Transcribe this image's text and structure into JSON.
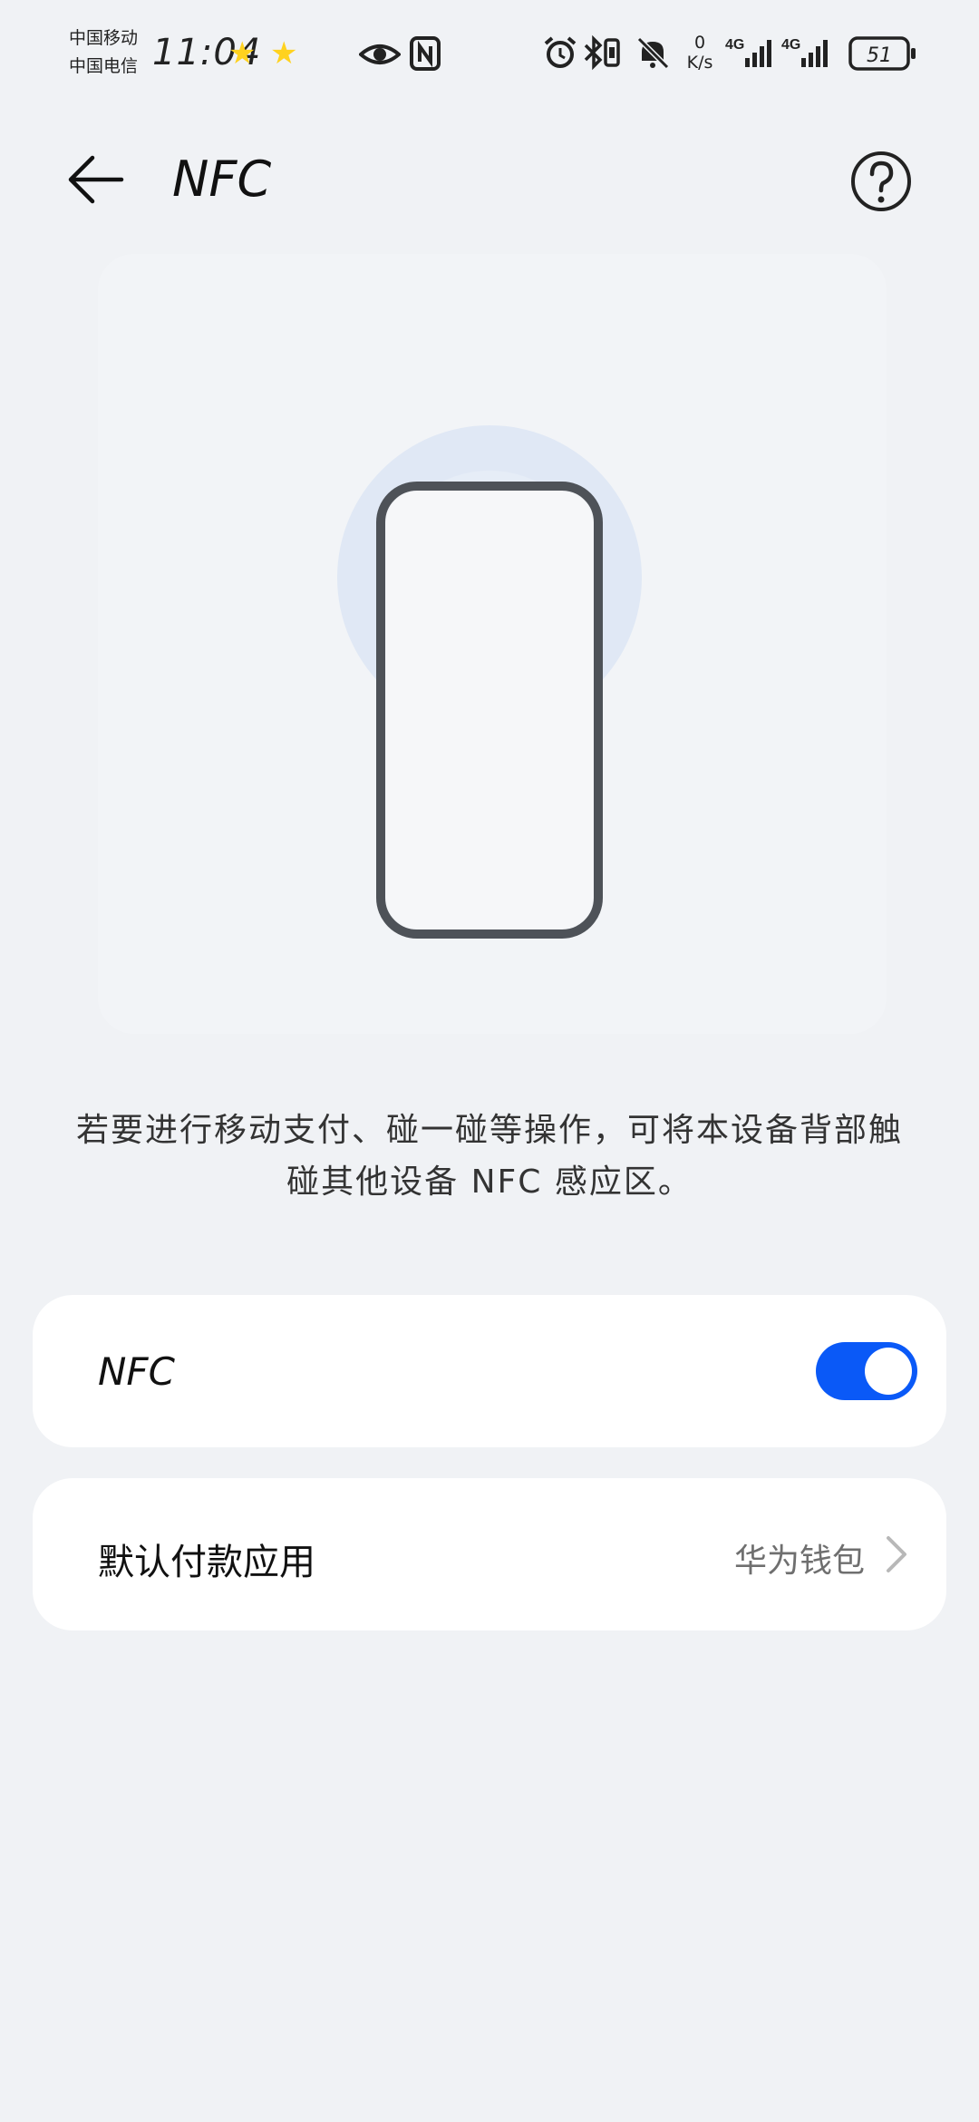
{
  "status_bar": {
    "carrier_1": "中国移动",
    "carrier_2": "中国电信",
    "time": "11:04",
    "net_speed_value": "0",
    "net_speed_unit": "K/s",
    "net_type_1": "4G",
    "net_type_2": "4G",
    "battery": "51",
    "icons": [
      "star-icon",
      "star-icon",
      "eye-icon",
      "nfc-icon",
      "alarm-icon",
      "bluetooth-icon",
      "vibrate-icon",
      "mute-icon",
      "signal-icon",
      "signal-icon",
      "battery-icon"
    ]
  },
  "header": {
    "title": "NFC",
    "back_icon": "arrow-left-icon",
    "help_icon": "help-circle-icon"
  },
  "illustration": {
    "icon": "phone-nfc-illustration"
  },
  "description": "若要进行移动支付、碰一碰等操作，可将本设备背部触碰其他设备 NFC 感应区。",
  "settings": {
    "nfc": {
      "label": "NFC",
      "enabled": true
    },
    "default_payment": {
      "label": "默认付款应用",
      "value": "华为钱包",
      "chevron_icon": "chevron-right-icon"
    }
  },
  "colors": {
    "background": "#f0f2f5",
    "accent": "#0a59f7",
    "card": "#ffffff"
  }
}
